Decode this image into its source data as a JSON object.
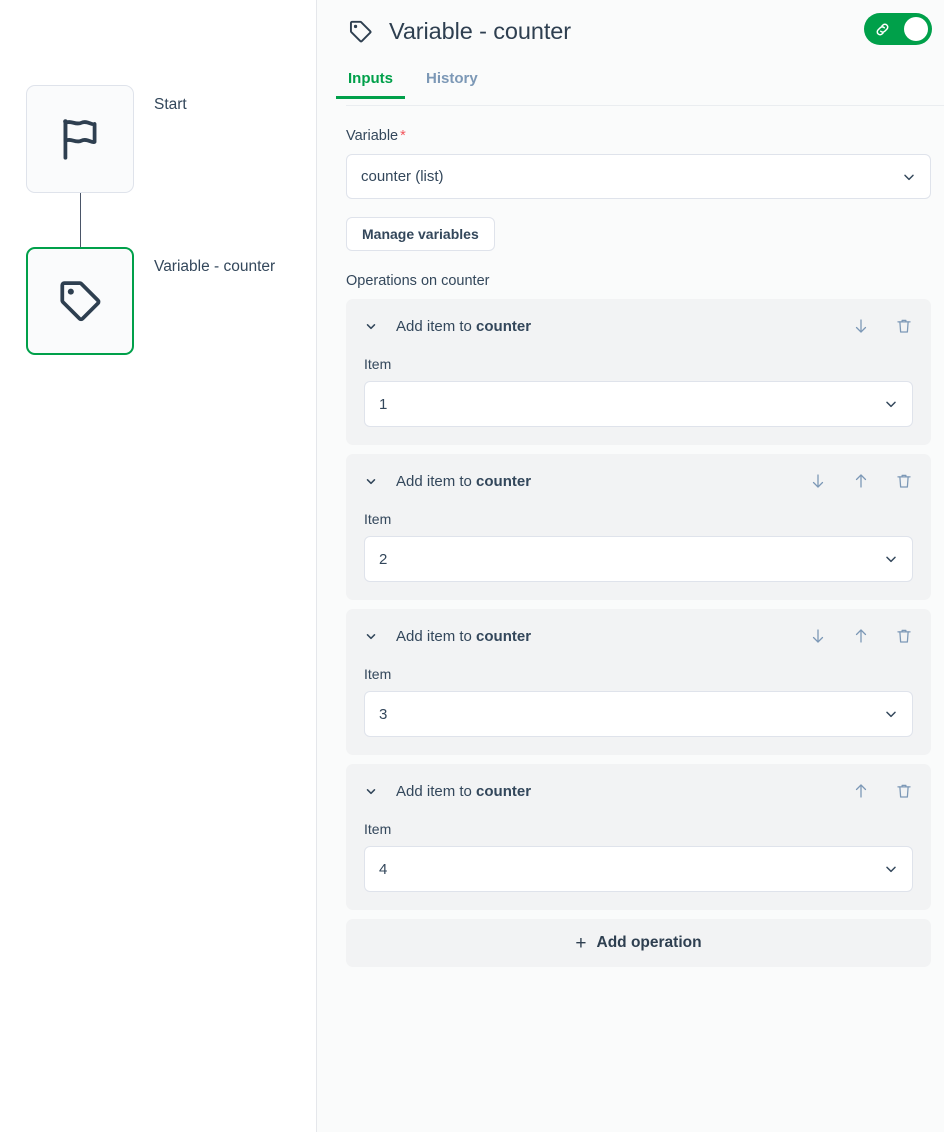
{
  "canvas": {
    "nodes": [
      {
        "label": "Start",
        "icon": "flag-icon",
        "selected": false
      },
      {
        "label": "Variable - counter",
        "icon": "tag-icon",
        "selected": true
      }
    ],
    "selected_border_color": "#00a04a"
  },
  "panel": {
    "header": {
      "icon": "tag-icon",
      "title": "Variable - counter",
      "toggle": {
        "icon": "link-icon",
        "enabled": true,
        "on_color": "#00a04a"
      }
    },
    "tabs": [
      {
        "label": "Inputs",
        "active": true
      },
      {
        "label": "History",
        "active": false
      }
    ],
    "active_tab_color": "#00a04a",
    "variable_field": {
      "label": "Variable",
      "required_marker": "*",
      "required_color": "#f2545b",
      "value": "counter (list)",
      "chevron": "chevron-down-icon"
    },
    "manage_variables_button": "Manage variables",
    "operations_label": "Operations on counter",
    "operations": [
      {
        "title_prefix": "Add item to ",
        "title_target": "counter",
        "item_label": "Item",
        "item_value": "1",
        "can_move_down": true,
        "can_move_up": false,
        "can_delete": true
      },
      {
        "title_prefix": "Add item to ",
        "title_target": "counter",
        "item_label": "Item",
        "item_value": "2",
        "can_move_down": true,
        "can_move_up": true,
        "can_delete": true
      },
      {
        "title_prefix": "Add item to ",
        "title_target": "counter",
        "item_label": "Item",
        "item_value": "3",
        "can_move_down": true,
        "can_move_up": true,
        "can_delete": true
      },
      {
        "title_prefix": "Add item to ",
        "title_target": "counter",
        "item_label": "Item",
        "item_value": "4",
        "can_move_down": false,
        "can_move_up": true,
        "can_delete": true
      }
    ],
    "add_operation_button": {
      "plus": "+",
      "label": "Add operation"
    }
  }
}
